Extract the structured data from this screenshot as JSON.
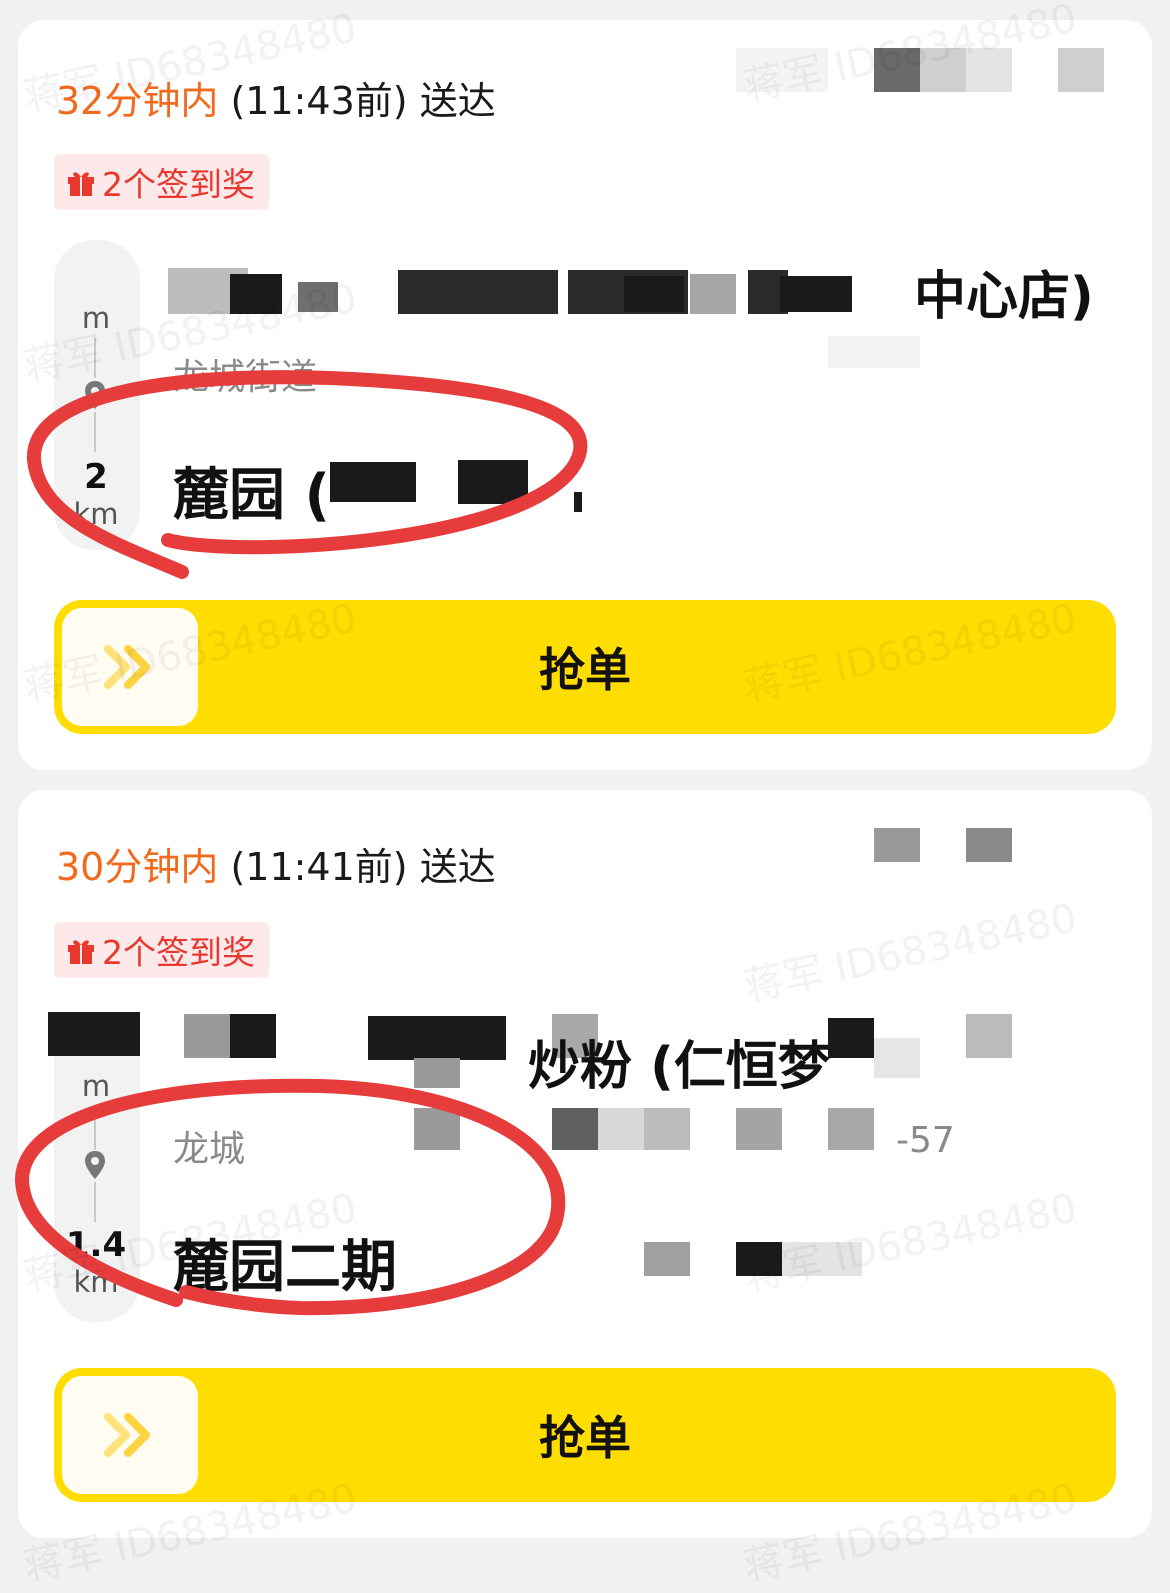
{
  "orders": [
    {
      "eta_minutes": "32分钟内",
      "eta_rest": "(11:43前) 送达",
      "badge": "2个签到奖",
      "shop_name_visible": "中心店)",
      "shop_address": "龙城街道",
      "distance_unit_top": "m",
      "distance_value": "2",
      "distance_unit": "km",
      "destination": "麓园 (",
      "grab_label": "抢单"
    },
    {
      "eta_minutes": "30分钟内",
      "eta_rest": "(11:41前) 送达",
      "badge": "2个签到奖",
      "shop_name_visible": "炒粉 (仁恒梦",
      "shop_address": "龙城",
      "shop_address_tail": "-57",
      "distance_unit_top": "m",
      "distance_value": "1.4",
      "distance_unit": "km",
      "destination": "麓园二期",
      "grab_label": "抢单"
    }
  ],
  "watermark": "蒋军 ID68348480",
  "colors": {
    "accent_orange": "#f26a1b",
    "badge_red": "#e8392f",
    "grab_yellow": "#ffdd00",
    "annotation_red": "#e63c3c"
  },
  "icons": [
    "gift-icon",
    "location-pin-icon",
    "double-chevron-right-icon"
  ]
}
